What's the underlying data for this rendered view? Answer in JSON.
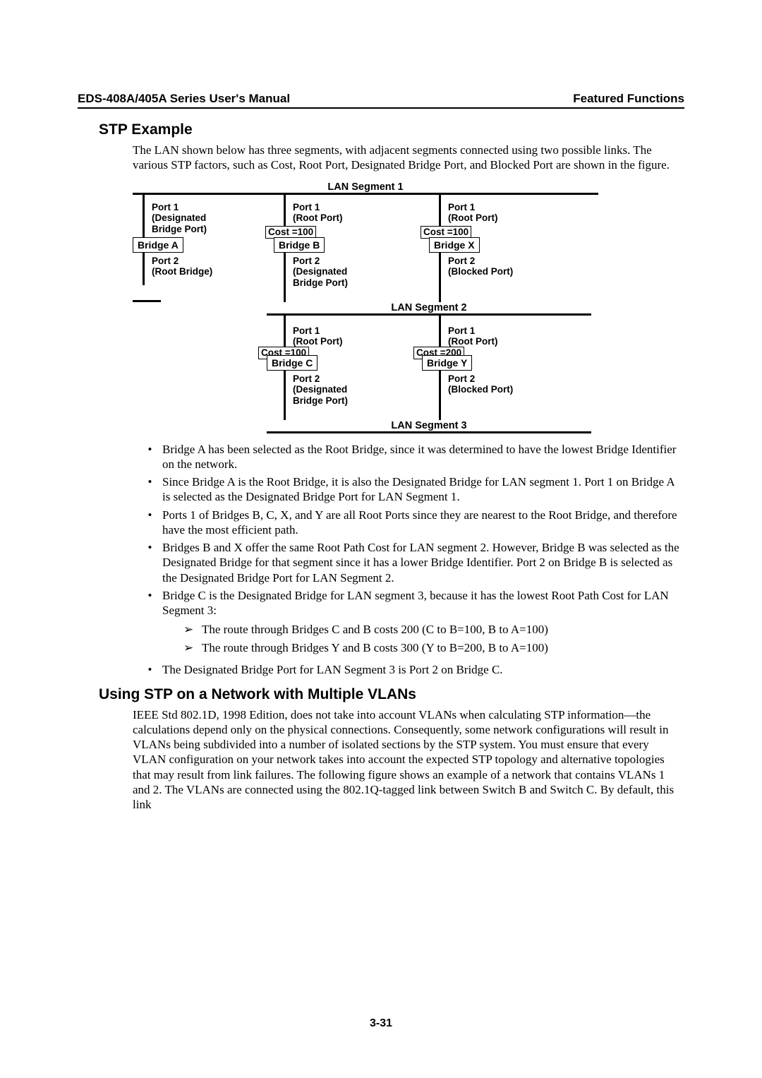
{
  "header": {
    "left": "EDS-408A/405A Series User's Manual",
    "right": "Featured Functions"
  },
  "stp": {
    "heading": "STP Example",
    "intro": "The LAN shown below has three segments, with adjacent segments connected using two possible links. The various STP factors, such as Cost, Root Port, Designated Bridge Port, and Blocked Port are shown in the figure."
  },
  "diagram": {
    "seg1": "LAN Segment 1",
    "seg2": "LAN Segment 2",
    "seg3": "LAN Segment 3",
    "a": {
      "name": "Bridge A",
      "p1": "Port 1\n(Designated\nBridge Port)",
      "p2": "Port 2\n(Root Bridge)"
    },
    "b": {
      "name": "Bridge B",
      "p1": "Port 1\n(Root Port)",
      "p2": "Port 2\n(Designated\nBridge Port)",
      "cost": "Cost =100"
    },
    "x": {
      "name": "Bridge X",
      "p1": "Port 1\n(Root Port)",
      "p2": "Port 2\n(Blocked Port)",
      "cost": "Cost =100"
    },
    "c": {
      "name": "Bridge C",
      "p1": "Port 1\n(Root Port)",
      "p2": "Port 2\n(Designated\nBridge Port)",
      "cost": "Cost =100"
    },
    "y": {
      "name": "Bridge Y",
      "p1": "Port 1\n(Root Port)",
      "p2": "Port 2\n(Blocked Port)",
      "cost": "Cost =200"
    }
  },
  "bullets": {
    "b1": "Bridge A has been selected as the Root Bridge, since it was determined to have the lowest Bridge Identifier on the network.",
    "b2": "Since Bridge A is the Root Bridge, it is also the Designated Bridge for LAN segment 1. Port 1 on Bridge A is selected as the Designated Bridge Port for LAN Segment 1.",
    "b3": "Ports 1 of Bridges B, C, X, and Y are all Root Ports since they are nearest to the Root Bridge, and therefore have the most efficient path.",
    "b4": "Bridges B and X offer the same Root Path Cost for LAN segment 2. However, Bridge B was selected as the Designated Bridge for that segment since it has a lower Bridge Identifier. Port 2 on Bridge B is selected as the Designated Bridge Port for LAN Segment 2.",
    "b5": "Bridge C is the Designated Bridge for LAN segment 3, because it has the lowest Root Path Cost for LAN Segment 3:",
    "b5a": "The route through Bridges C and B costs 200 (C to B=100, B to A=100)",
    "b5b": "The route through Bridges Y and B costs 300 (Y to B=200, B to A=100)",
    "b6": "The Designated Bridge Port for LAN Segment 3 is Port 2 on Bridge C."
  },
  "vlan": {
    "heading": "Using STP on a Network with Multiple VLANs",
    "para": "IEEE Std 802.1D, 1998 Edition, does not take into account VLANs when calculating STP information—the calculations depend only on the physical connections. Consequently, some network configurations will result in VLANs being subdivided into a number of isolated sections by the STP system. You must ensure that every VLAN configuration on your network takes into account the expected STP topology and alternative topologies that may result from link failures. The following figure shows an example of a network that contains VLANs 1 and 2. The VLANs are connected using the 802.1Q-tagged link between Switch B and Switch C. By default, this link"
  },
  "footer": "3-31"
}
